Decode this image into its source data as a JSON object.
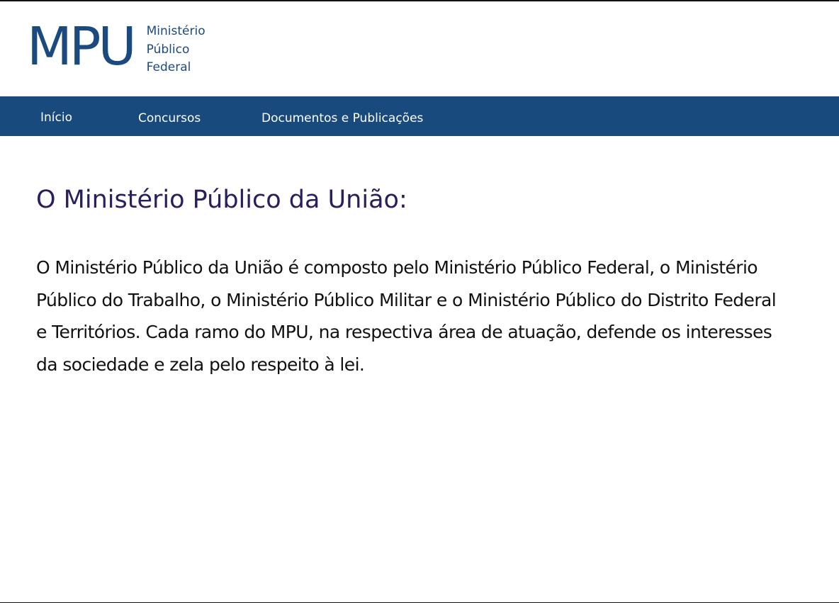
{
  "logo": {
    "mark": "MPU",
    "line1": "Ministério",
    "line2": "Público",
    "line3": "Federal"
  },
  "nav": {
    "items": [
      {
        "label": "Início"
      },
      {
        "label": "Concursos"
      },
      {
        "label": "Documentos e Publicações"
      }
    ]
  },
  "main": {
    "title": "O Ministério Público da União:",
    "paragraph": "O Ministério Público da União é composto pelo Ministério Público Federal, o Ministério Público do Trabalho, o Ministério Público Militar e o Ministério Público do Distrito Federal e Territórios. Cada ramo do MPU, na respectiva área de atuação, defende os interesses da sociedade e zela pelo respeito à lei."
  },
  "colors": {
    "brand": "#1b4a7e",
    "navbar": "#184a7e",
    "title": "#26205e",
    "text": "#111111"
  }
}
